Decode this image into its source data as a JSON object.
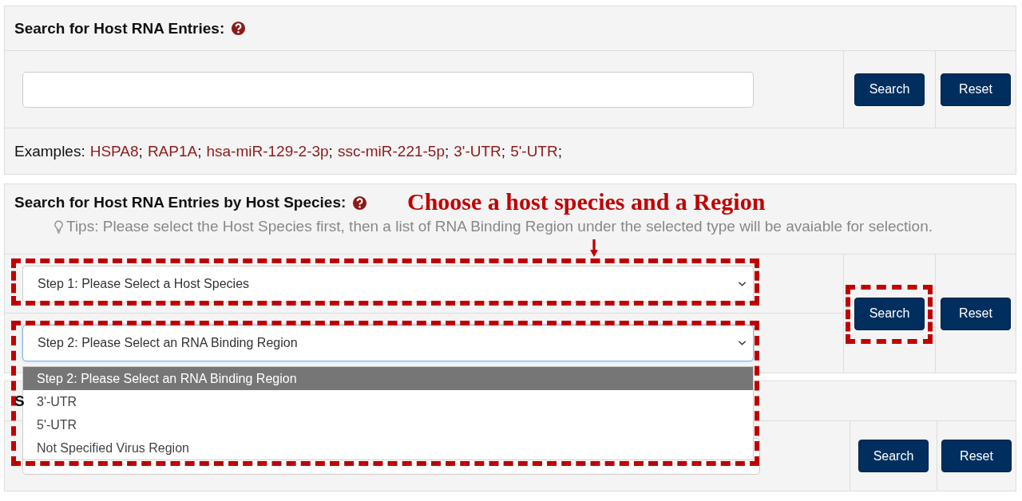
{
  "entries_panel": {
    "title": "Search for Host RNA Entries:",
    "search_button": "Search",
    "reset_button": "Reset",
    "examples_label": "Examples:",
    "separator": ";",
    "examples": [
      "HSPA8",
      "RAP1A",
      "hsa-miR-129-2-3p",
      "ssc-miR-221-5p",
      "3'-UTR",
      "5'-UTR"
    ]
  },
  "species_panel": {
    "title": "Search for Host RNA Entries by Host Species:",
    "tip": "Tips: Please select the Host Species first, then a list of RNA Binding Region under the selected type will be avaiable for selection.",
    "search_button": "Search",
    "reset_button": "Reset",
    "selects": [
      {
        "value": "Step 1: Please Select a Host Species",
        "expanded": false
      },
      {
        "value": "Step 2: Please Select an RNA Binding Region",
        "expanded": true,
        "options": [
          {
            "label": "Step 2: Please Select an RNA Binding Region",
            "selected": true
          },
          {
            "label": "3'-UTR",
            "selected": false
          },
          {
            "label": "5'-UTR",
            "selected": false
          },
          {
            "label": "Not Specified Virus Region",
            "selected": false
          }
        ]
      }
    ]
  },
  "third_panel": {
    "title": "S",
    "search_button": "Search",
    "reset_button": "Reset"
  },
  "annotation": {
    "text": "Choose a host species and a Region"
  }
}
